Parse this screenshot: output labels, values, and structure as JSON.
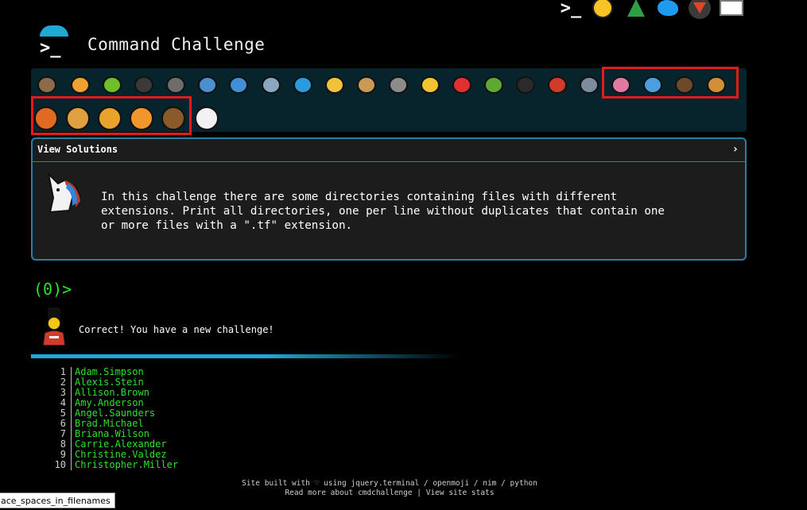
{
  "social": [
    {
      "icon": "terminal-icon",
      "glyph": ">_"
    },
    {
      "icon": "shushing-face-icon"
    },
    {
      "icon": "tree-icon"
    },
    {
      "icon": "twitter-icon"
    },
    {
      "icon": "gitlab-icon"
    },
    {
      "icon": "mail-icon"
    }
  ],
  "header": {
    "title": "Command Challenge",
    "logo_glyph": ">_"
  },
  "animals_row1": [
    {
      "name": "snail-icon",
      "color": "#8b6b4a"
    },
    {
      "name": "butterfly-icon",
      "color": "#f0a030"
    },
    {
      "name": "caterpillar-icon",
      "color": "#6fbf2b"
    },
    {
      "name": "ant-icon",
      "color": "#3a3a3a"
    },
    {
      "name": "spider-web-icon",
      "color": "#6d6d6d"
    },
    {
      "name": "whale-icon",
      "color": "#4a8fd0"
    },
    {
      "name": "shark-icon",
      "color": "#3f90d8"
    },
    {
      "name": "dolphin-icon",
      "color": "#8aa7bf"
    },
    {
      "name": "fish-icon",
      "color": "#2b9be0"
    },
    {
      "name": "tropical-fish-icon",
      "color": "#f2c23a"
    },
    {
      "name": "blowfish-icon",
      "color": "#c99a55"
    },
    {
      "name": "wolf-icon",
      "color": "#8c8c8c"
    },
    {
      "name": "bee-icon",
      "color": "#f0c330"
    },
    {
      "name": "ladybug-icon",
      "color": "#e03030"
    },
    {
      "name": "cricket-icon",
      "color": "#5fa832"
    },
    {
      "name": "spider-icon",
      "color": "#2a2a2a"
    },
    {
      "name": "scorpion-icon",
      "color": "#d23a2a"
    },
    {
      "name": "fly-icon",
      "color": "#7c8c9c"
    },
    {
      "name": "worm-icon",
      "color": "#e07aa0"
    },
    {
      "name": "microbe-icon",
      "color": "#4a9fe0"
    },
    {
      "name": "monkey-icon",
      "color": "#6a4a2a"
    },
    {
      "name": "dog-icon",
      "color": "#d09035"
    }
  ],
  "animals_row2": [
    {
      "name": "fox-icon",
      "color": "#e06a22"
    },
    {
      "name": "cat-icon",
      "color": "#e0a040"
    },
    {
      "name": "lion-icon",
      "color": "#e8a32c"
    },
    {
      "name": "tiger-icon",
      "color": "#f0962c"
    },
    {
      "name": "horse-icon",
      "color": "#8a5a2a"
    },
    {
      "name": "unicorn-icon",
      "color": "#f2f2f2"
    }
  ],
  "solutions": {
    "title": "View Solutions",
    "chevron": "›"
  },
  "description": "In this challenge there are some directories containing files with different\nextensions. Print all directories, one per line without duplicates that contain one\nor more files with a \".tf\" extension.",
  "prompt": {
    "counter": "(0)>"
  },
  "result": {
    "message": "Correct! You have a new challenge!"
  },
  "output": [
    {
      "n": "1",
      "v": "Adam.Simpson"
    },
    {
      "n": "2",
      "v": "Alexis.Stein"
    },
    {
      "n": "3",
      "v": "Allison.Brown"
    },
    {
      "n": "4",
      "v": "Amy.Anderson"
    },
    {
      "n": "5",
      "v": "Angel.Saunders"
    },
    {
      "n": "6",
      "v": "Brad.Michael"
    },
    {
      "n": "7",
      "v": "Briana.Wilson"
    },
    {
      "n": "8",
      "v": "Carrie.Alexander"
    },
    {
      "n": "9",
      "v": "Christine.Valdez"
    },
    {
      "n": "10",
      "v": "Christopher.Miller"
    }
  ],
  "footer": {
    "line1": "Site built with ♡ using jquery.terminal / openmoji / nim / python",
    "line2": "Read more about cmdchallenge | View site stats"
  },
  "tooltip": "ace_spaces_in_filenames"
}
